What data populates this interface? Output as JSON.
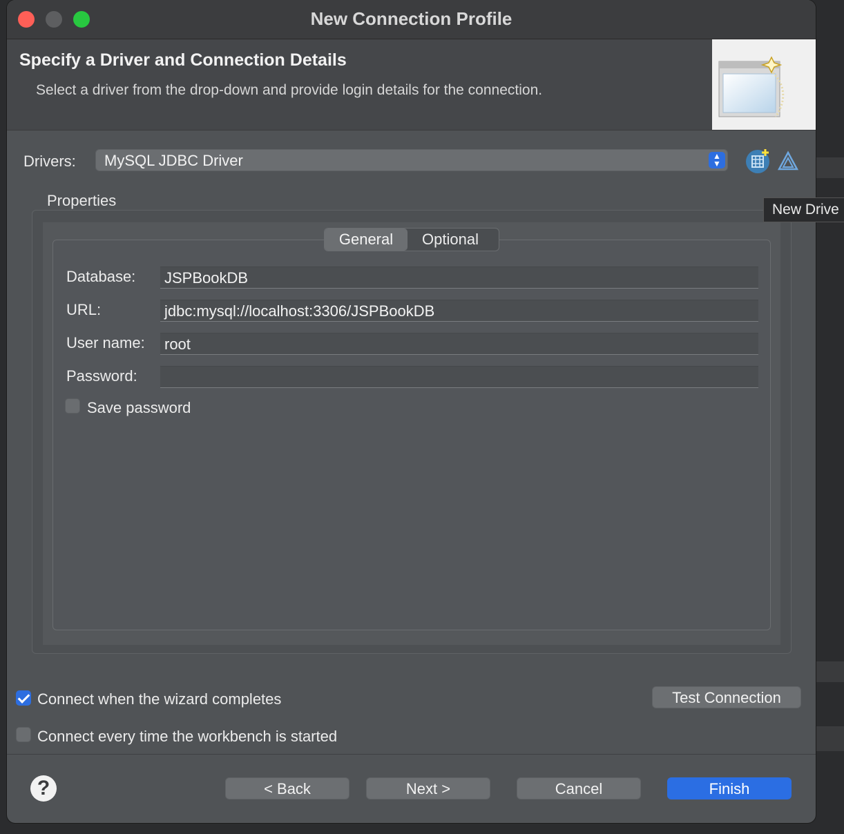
{
  "window": {
    "title": "New Connection Profile"
  },
  "header": {
    "title": "Specify a Driver and Connection Details",
    "description": "Select a driver from the drop-down and provide login details for the connection."
  },
  "drivers": {
    "label": "Drivers:",
    "selected": "MySQL JDBC Driver"
  },
  "tooltip": {
    "text": "New Drive"
  },
  "properties": {
    "label": "Properties",
    "tabs": [
      {
        "label": "General",
        "active": true
      },
      {
        "label": "Optional",
        "active": false
      }
    ],
    "fields": {
      "database": {
        "label": "Database:",
        "value": "JSPBookDB"
      },
      "url": {
        "label": "URL:",
        "value": "jdbc:mysql://localhost:3306/JSPBookDB"
      },
      "username": {
        "label": "User name:",
        "value": "root"
      },
      "password": {
        "label": "Password:",
        "value": ""
      }
    },
    "save_password": {
      "label": "Save password",
      "checked": false
    }
  },
  "options": {
    "connect_on_finish": {
      "label": "Connect when the wizard completes",
      "checked": true
    },
    "connect_on_startup": {
      "label": "Connect every time the workbench is started",
      "checked": false
    },
    "test_connection_label": "Test Connection"
  },
  "footer": {
    "back_label": "< Back",
    "next_label": "Next >",
    "cancel_label": "Cancel",
    "finish_label": "Finish"
  },
  "colors": {
    "accent": "#2b6ee3",
    "dialog_bg": "#505356",
    "close": "#fe5f57",
    "maximize": "#28c840"
  }
}
